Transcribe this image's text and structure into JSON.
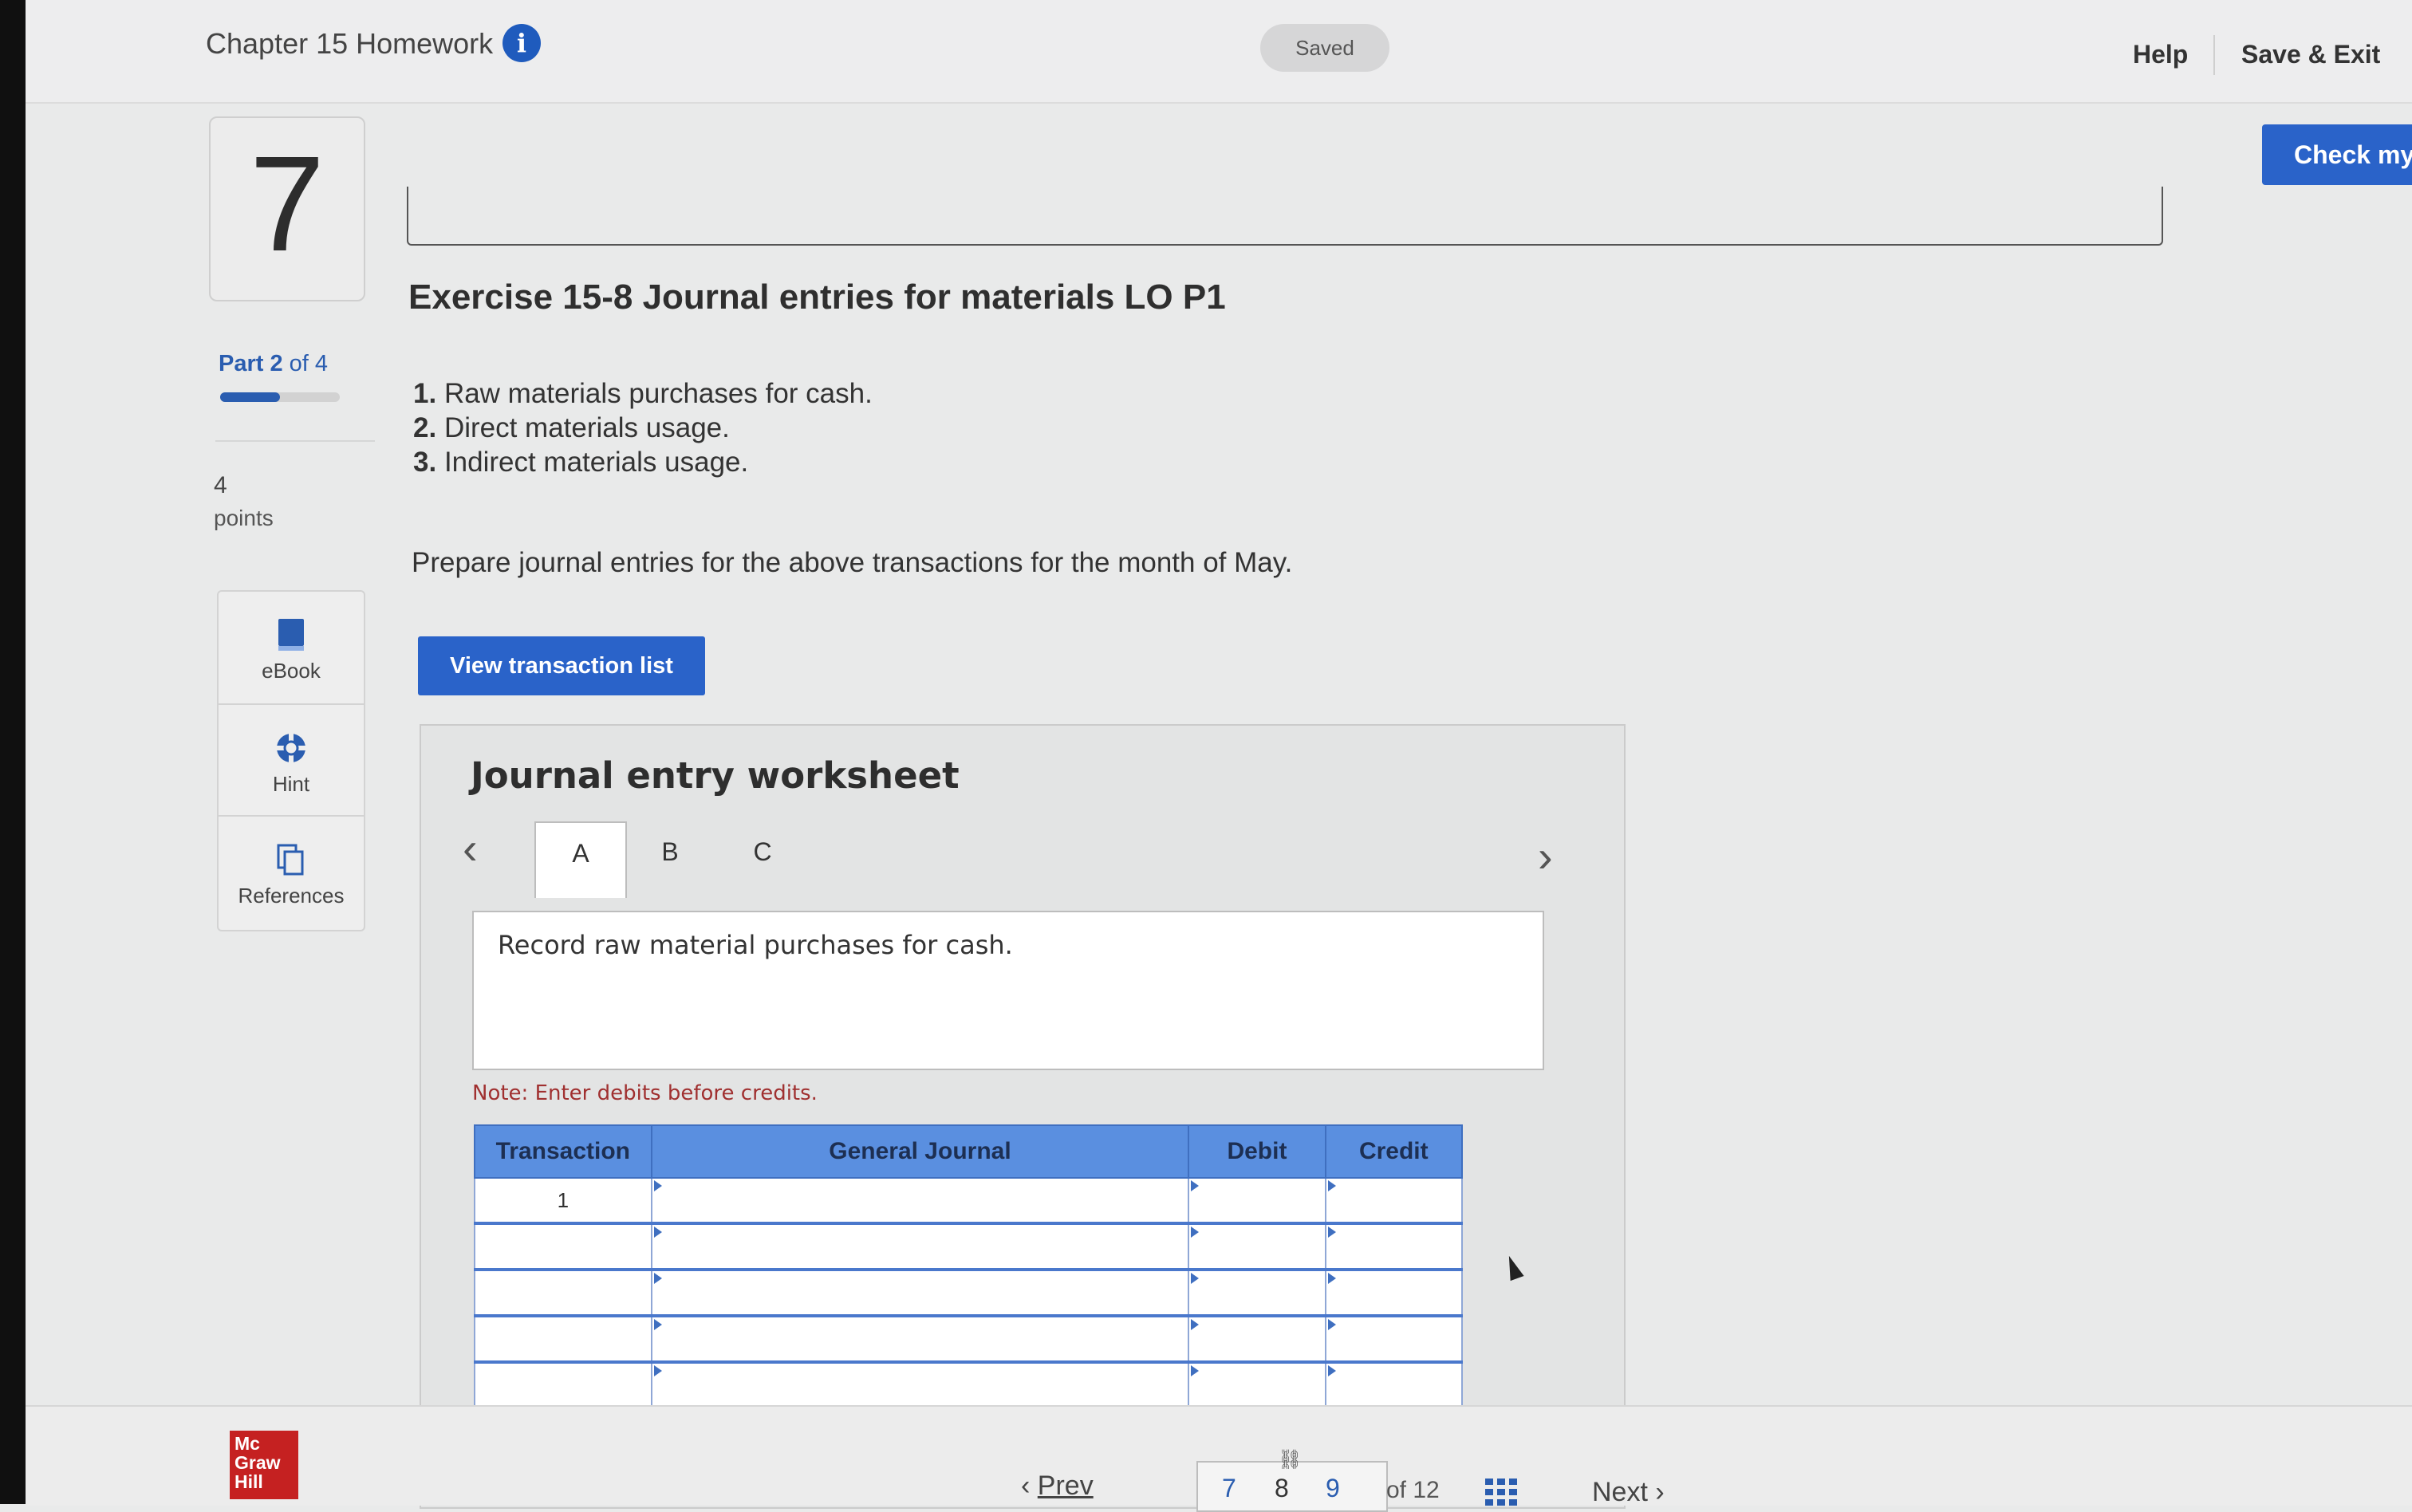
{
  "header": {
    "title": "Chapter 15 Homework",
    "info_icon": "i",
    "status": "Saved",
    "help": "Help",
    "save_exit": "Save & Exit",
    "check_button": "Check my"
  },
  "question": {
    "number": "7",
    "part_label": "Part 2",
    "part_of": "of 4",
    "progress_fraction": 0.5,
    "points_value": "4",
    "points_label": "points"
  },
  "tools": [
    {
      "label": "eBook",
      "icon": "book-icon"
    },
    {
      "label": "Hint",
      "icon": "lifebuoy-icon"
    },
    {
      "label": "References",
      "icon": "copy-icon"
    }
  ],
  "exercise": {
    "title": "Exercise 15-8 Journal entries for materials LO P1",
    "items": [
      {
        "num": "1.",
        "text": "Raw materials purchases for cash."
      },
      {
        "num": "2.",
        "text": "Direct materials usage."
      },
      {
        "num": "3.",
        "text": "Indirect materials usage."
      }
    ],
    "instruction": "Prepare journal entries for the above transactions for the month of May.",
    "view_button": "View transaction list"
  },
  "worksheet": {
    "title": "Journal entry worksheet",
    "prev_arrow": "‹",
    "next_arrow": "›",
    "tabs": [
      "A",
      "B",
      "C"
    ],
    "active_tab": "A",
    "description": "Record raw material purchases for cash.",
    "note": "Note: Enter debits before credits.",
    "columns": [
      "Transaction",
      "General Journal",
      "Debit",
      "Credit"
    ],
    "rows": [
      {
        "transaction": "1"
      },
      {
        "transaction": ""
      },
      {
        "transaction": ""
      },
      {
        "transaction": ""
      },
      {
        "transaction": ""
      },
      {
        "transaction": ""
      }
    ]
  },
  "footer": {
    "logo_text": "Mc Graw Hill",
    "prev": "Prev",
    "pages": [
      "7",
      "8",
      "9"
    ],
    "current_page": "8",
    "of_total": "of 12",
    "next": "Next"
  },
  "colors": {
    "accent": "#2a63c9",
    "table_header": "#5a8fe0",
    "logo_red": "#c52121",
    "note_red": "#a03030"
  }
}
